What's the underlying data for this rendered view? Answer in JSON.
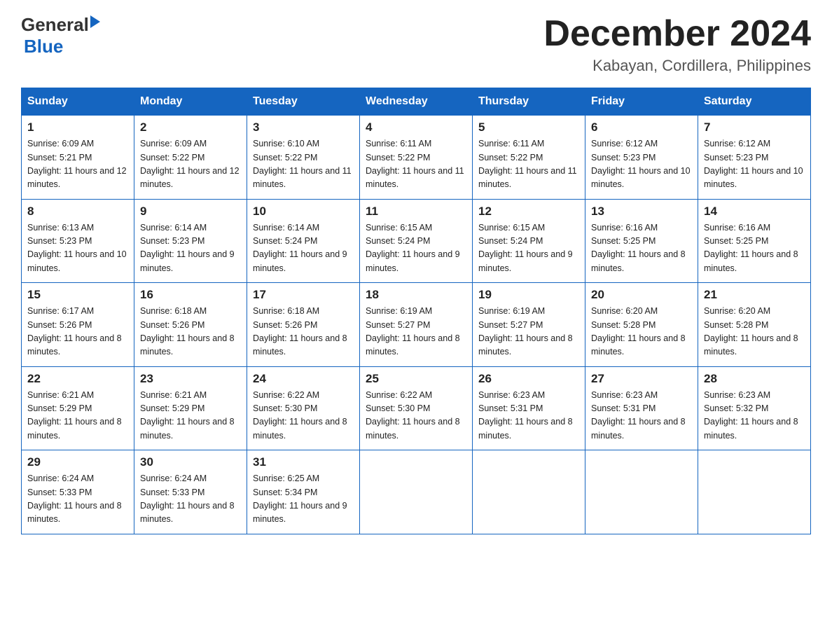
{
  "header": {
    "logo_general": "General",
    "logo_blue": "Blue",
    "month_title": "December 2024",
    "location": "Kabayan, Cordillera, Philippines"
  },
  "days_of_week": [
    "Sunday",
    "Monday",
    "Tuesday",
    "Wednesday",
    "Thursday",
    "Friday",
    "Saturday"
  ],
  "weeks": [
    [
      {
        "day": "1",
        "sunrise": "6:09 AM",
        "sunset": "5:21 PM",
        "daylight": "11 hours and 12 minutes."
      },
      {
        "day": "2",
        "sunrise": "6:09 AM",
        "sunset": "5:22 PM",
        "daylight": "11 hours and 12 minutes."
      },
      {
        "day": "3",
        "sunrise": "6:10 AM",
        "sunset": "5:22 PM",
        "daylight": "11 hours and 11 minutes."
      },
      {
        "day": "4",
        "sunrise": "6:11 AM",
        "sunset": "5:22 PM",
        "daylight": "11 hours and 11 minutes."
      },
      {
        "day": "5",
        "sunrise": "6:11 AM",
        "sunset": "5:22 PM",
        "daylight": "11 hours and 11 minutes."
      },
      {
        "day": "6",
        "sunrise": "6:12 AM",
        "sunset": "5:23 PM",
        "daylight": "11 hours and 10 minutes."
      },
      {
        "day": "7",
        "sunrise": "6:12 AM",
        "sunset": "5:23 PM",
        "daylight": "11 hours and 10 minutes."
      }
    ],
    [
      {
        "day": "8",
        "sunrise": "6:13 AM",
        "sunset": "5:23 PM",
        "daylight": "11 hours and 10 minutes."
      },
      {
        "day": "9",
        "sunrise": "6:14 AM",
        "sunset": "5:23 PM",
        "daylight": "11 hours and 9 minutes."
      },
      {
        "day": "10",
        "sunrise": "6:14 AM",
        "sunset": "5:24 PM",
        "daylight": "11 hours and 9 minutes."
      },
      {
        "day": "11",
        "sunrise": "6:15 AM",
        "sunset": "5:24 PM",
        "daylight": "11 hours and 9 minutes."
      },
      {
        "day": "12",
        "sunrise": "6:15 AM",
        "sunset": "5:24 PM",
        "daylight": "11 hours and 9 minutes."
      },
      {
        "day": "13",
        "sunrise": "6:16 AM",
        "sunset": "5:25 PM",
        "daylight": "11 hours and 8 minutes."
      },
      {
        "day": "14",
        "sunrise": "6:16 AM",
        "sunset": "5:25 PM",
        "daylight": "11 hours and 8 minutes."
      }
    ],
    [
      {
        "day": "15",
        "sunrise": "6:17 AM",
        "sunset": "5:26 PM",
        "daylight": "11 hours and 8 minutes."
      },
      {
        "day": "16",
        "sunrise": "6:18 AM",
        "sunset": "5:26 PM",
        "daylight": "11 hours and 8 minutes."
      },
      {
        "day": "17",
        "sunrise": "6:18 AM",
        "sunset": "5:26 PM",
        "daylight": "11 hours and 8 minutes."
      },
      {
        "day": "18",
        "sunrise": "6:19 AM",
        "sunset": "5:27 PM",
        "daylight": "11 hours and 8 minutes."
      },
      {
        "day": "19",
        "sunrise": "6:19 AM",
        "sunset": "5:27 PM",
        "daylight": "11 hours and 8 minutes."
      },
      {
        "day": "20",
        "sunrise": "6:20 AM",
        "sunset": "5:28 PM",
        "daylight": "11 hours and 8 minutes."
      },
      {
        "day": "21",
        "sunrise": "6:20 AM",
        "sunset": "5:28 PM",
        "daylight": "11 hours and 8 minutes."
      }
    ],
    [
      {
        "day": "22",
        "sunrise": "6:21 AM",
        "sunset": "5:29 PM",
        "daylight": "11 hours and 8 minutes."
      },
      {
        "day": "23",
        "sunrise": "6:21 AM",
        "sunset": "5:29 PM",
        "daylight": "11 hours and 8 minutes."
      },
      {
        "day": "24",
        "sunrise": "6:22 AM",
        "sunset": "5:30 PM",
        "daylight": "11 hours and 8 minutes."
      },
      {
        "day": "25",
        "sunrise": "6:22 AM",
        "sunset": "5:30 PM",
        "daylight": "11 hours and 8 minutes."
      },
      {
        "day": "26",
        "sunrise": "6:23 AM",
        "sunset": "5:31 PM",
        "daylight": "11 hours and 8 minutes."
      },
      {
        "day": "27",
        "sunrise": "6:23 AM",
        "sunset": "5:31 PM",
        "daylight": "11 hours and 8 minutes."
      },
      {
        "day": "28",
        "sunrise": "6:23 AM",
        "sunset": "5:32 PM",
        "daylight": "11 hours and 8 minutes."
      }
    ],
    [
      {
        "day": "29",
        "sunrise": "6:24 AM",
        "sunset": "5:33 PM",
        "daylight": "11 hours and 8 minutes."
      },
      {
        "day": "30",
        "sunrise": "6:24 AM",
        "sunset": "5:33 PM",
        "daylight": "11 hours and 8 minutes."
      },
      {
        "day": "31",
        "sunrise": "6:25 AM",
        "sunset": "5:34 PM",
        "daylight": "11 hours and 9 minutes."
      },
      null,
      null,
      null,
      null
    ]
  ]
}
